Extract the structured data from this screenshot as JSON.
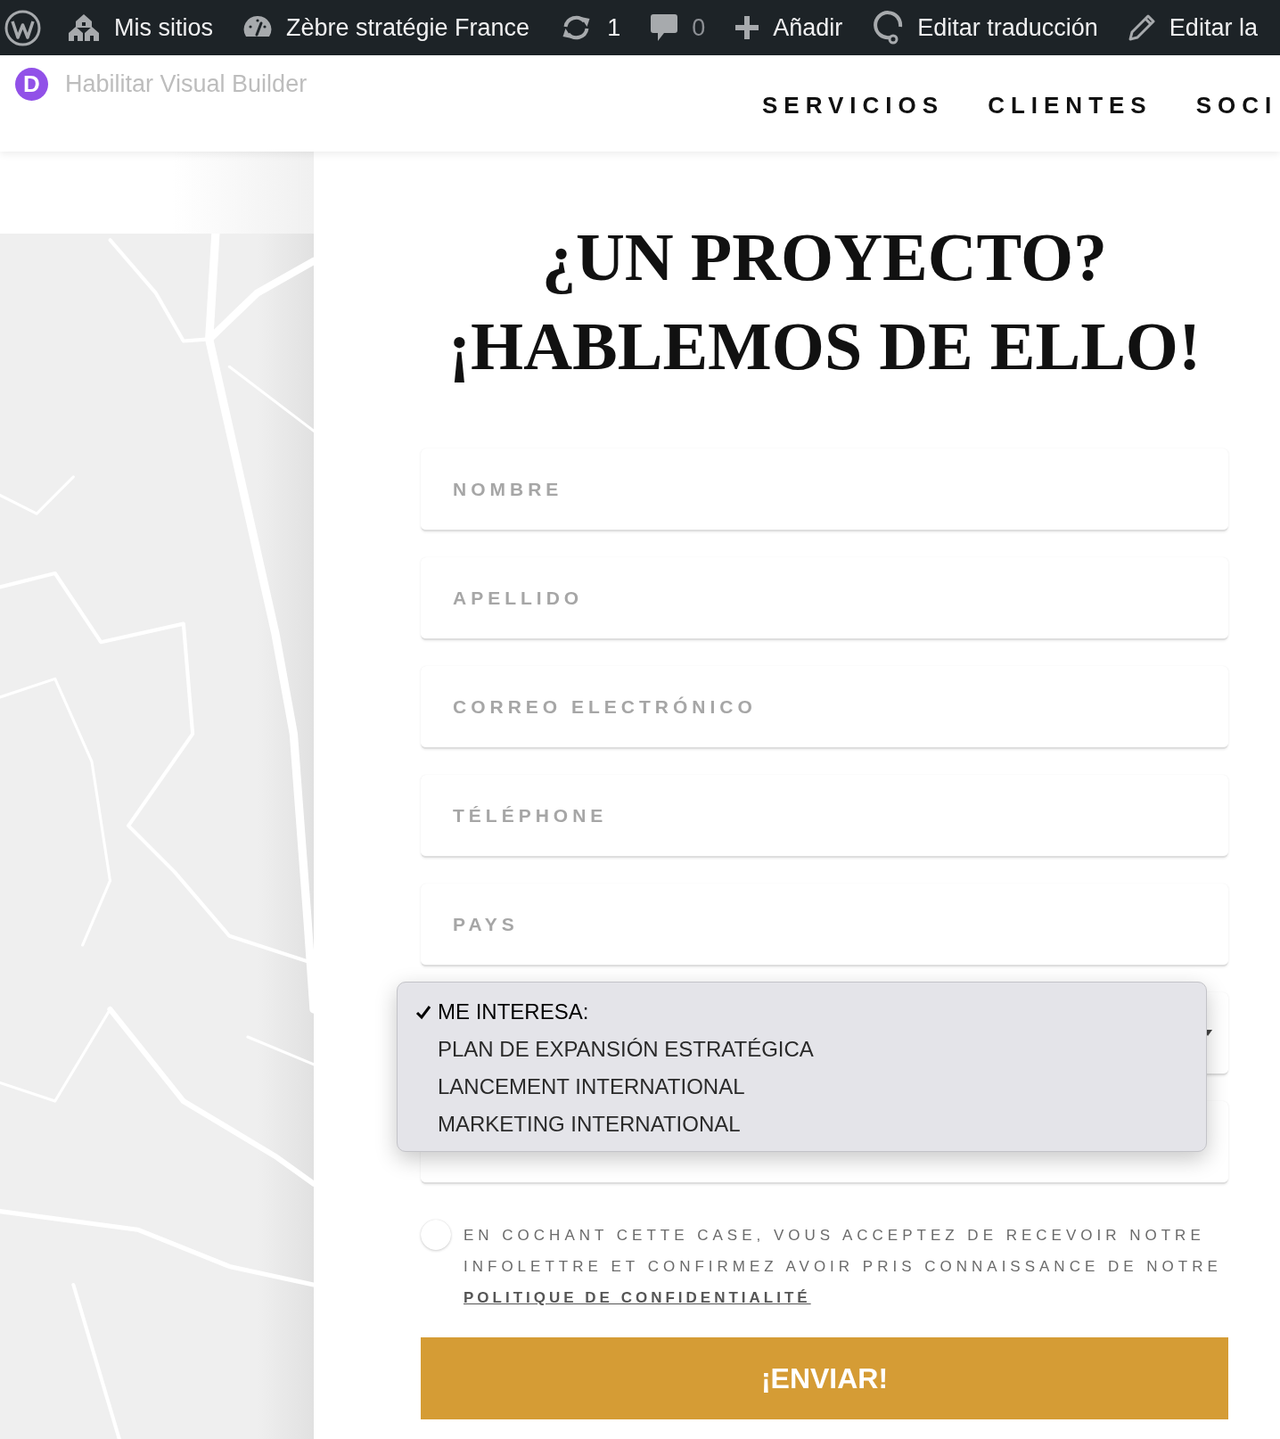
{
  "admin_bar": {
    "items": [
      {
        "kind": "sites",
        "label": "Mis sitios"
      },
      {
        "kind": "dashboard",
        "label": "Zèbre stratégie France"
      },
      {
        "kind": "updates",
        "label": "1"
      },
      {
        "kind": "comments",
        "label": "0"
      },
      {
        "kind": "new",
        "label": "Añadir"
      },
      {
        "kind": "translate",
        "label": "Editar traducción"
      },
      {
        "kind": "edit",
        "label": "Editar la"
      }
    ]
  },
  "header": {
    "builder": {
      "logo_letter": "D",
      "label": "Habilitar Visual Builder"
    },
    "nav": [
      "SERVICIOS",
      "CLIENTES",
      "SOCI"
    ]
  },
  "contact": {
    "heading": "¿UN PROYECTO? ¡HABLEMOS DE ELLO!",
    "fields": [
      {
        "kind": "text",
        "placeholder": "NOMBRE"
      },
      {
        "kind": "text",
        "placeholder": "APELLIDO"
      },
      {
        "kind": "text",
        "placeholder": "CORREO ELECTRÓNICO"
      },
      {
        "kind": "text",
        "placeholder": "TÉLÉPHONE"
      },
      {
        "kind": "text",
        "placeholder": "PAYS"
      },
      {
        "kind": "select",
        "expanded": true,
        "options": [
          {
            "label": "ME INTERESA:",
            "selected": true
          },
          {
            "label": "PLAN DE EXPANSIÓN ESTRATÉGICA",
            "selected": false
          },
          {
            "label": "LANCEMENT INTERNATIONAL",
            "selected": false
          },
          {
            "label": "MARKETING INTERNATIONAL",
            "selected": false
          }
        ]
      },
      {
        "kind": "textarea"
      }
    ],
    "consent": {
      "checked": false,
      "text": "EN COCHANT CETTE CASE, VOUS ACCEPTEZ DE RECEVOIR NOTRE INFOLETTRE ET CONFIRMEZ AVOIR PRIS CONNAISSANCE DE NOTRE",
      "link": "POLITIQUE DE CONFIDENTIALITÉ"
    },
    "submit": "¡ENVIAR!"
  }
}
